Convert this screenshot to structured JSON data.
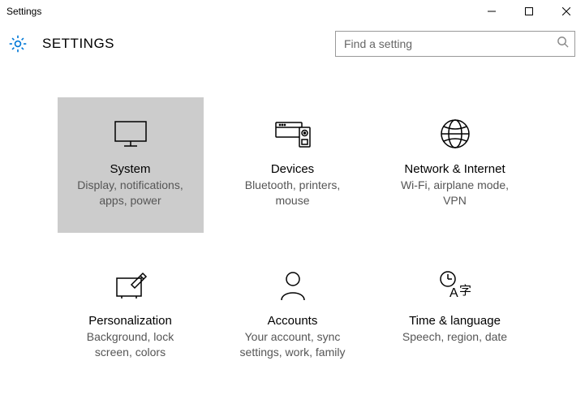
{
  "window": {
    "title": "Settings"
  },
  "header": {
    "page_title": "SETTINGS"
  },
  "search": {
    "placeholder": "Find a setting",
    "value": ""
  },
  "tiles": [
    {
      "title": "System",
      "desc": "Display, notifications, apps, power",
      "icon": "monitor",
      "selected": true
    },
    {
      "title": "Devices",
      "desc": "Bluetooth, printers, mouse",
      "icon": "devices",
      "selected": false
    },
    {
      "title": "Network & Internet",
      "desc": "Wi-Fi, airplane mode, VPN",
      "icon": "globe",
      "selected": false
    },
    {
      "title": "Personalization",
      "desc": "Background, lock screen, colors",
      "icon": "personalization",
      "selected": false
    },
    {
      "title": "Accounts",
      "desc": "Your account, sync settings, work, family",
      "icon": "person",
      "selected": false
    },
    {
      "title": "Time & language",
      "desc": "Speech, region, date",
      "icon": "time-language",
      "selected": false
    }
  ]
}
